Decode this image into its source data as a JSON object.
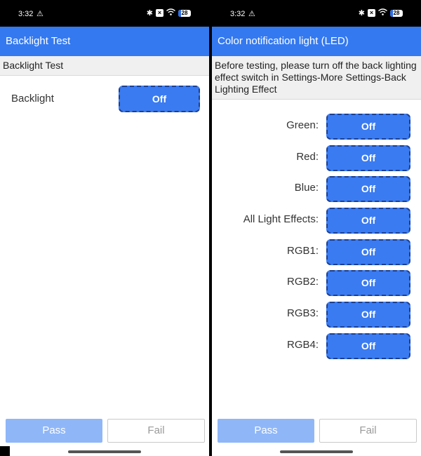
{
  "status": {
    "time": "3:32",
    "warning_icon": "warning-icon",
    "battery": "28"
  },
  "left_screen": {
    "title": "Backlight Test",
    "subheader": "Backlight Test",
    "backlight_label": "Backlight",
    "backlight_value": "Off",
    "pass_label": "Pass",
    "fail_label": "Fail"
  },
  "right_screen": {
    "title": "Color notification light (LED)",
    "subheader": "Before testing, please turn off the back lighting effect switch in Settings-More Settings-Back Lighting Effect",
    "leds": [
      {
        "label": "Green:",
        "value": "Off"
      },
      {
        "label": "Red:",
        "value": "Off"
      },
      {
        "label": "Blue:",
        "value": "Off"
      },
      {
        "label": "All Light Effects:",
        "value": "Off"
      },
      {
        "label": "RGB1:",
        "value": "Off"
      },
      {
        "label": "RGB2:",
        "value": "Off"
      },
      {
        "label": "RGB3:",
        "value": "Off"
      },
      {
        "label": "RGB4:",
        "value": "Off"
      }
    ],
    "pass_label": "Pass",
    "fail_label": "Fail"
  },
  "colors": {
    "appbar": "#3479f0",
    "toggle": "#3a7bf2",
    "pass_disabled": "#8fb7f8"
  }
}
